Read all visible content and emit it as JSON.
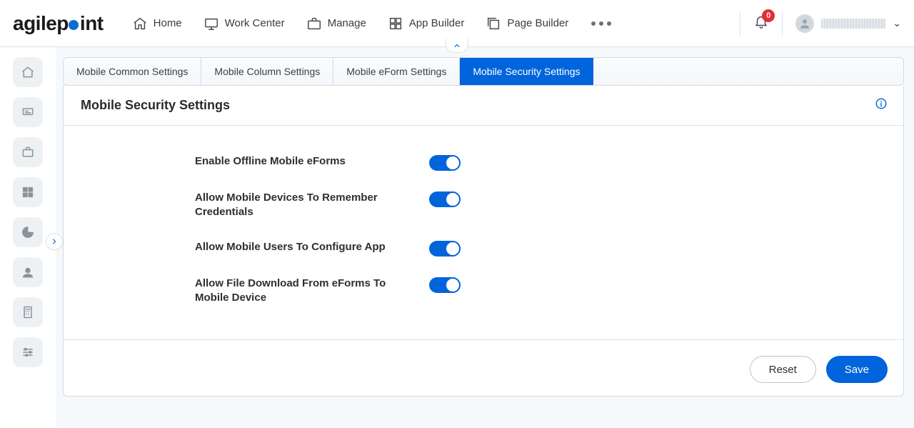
{
  "brand": {
    "name_part1": "agilep",
    "name_part2": "int"
  },
  "nav": {
    "items": [
      {
        "label": "Home"
      },
      {
        "label": "Work Center"
      },
      {
        "label": "Manage"
      },
      {
        "label": "App Builder"
      },
      {
        "label": "Page Builder"
      }
    ]
  },
  "notifications": {
    "count": "0"
  },
  "tabs": {
    "items": [
      {
        "label": "Mobile Common Settings",
        "active": false
      },
      {
        "label": "Mobile Column Settings",
        "active": false
      },
      {
        "label": "Mobile eForm Settings",
        "active": false
      },
      {
        "label": "Mobile Security Settings",
        "active": true
      }
    ]
  },
  "page": {
    "title": "Mobile Security Settings"
  },
  "settings": {
    "items": [
      {
        "label": "Enable Offline Mobile eForms",
        "on": true
      },
      {
        "label": "Allow Mobile Devices To Remember Credentials",
        "on": true
      },
      {
        "label": "Allow Mobile Users To Configure App",
        "on": true
      },
      {
        "label": "Allow File Download From eForms To Mobile Device",
        "on": true
      }
    ]
  },
  "buttons": {
    "reset": "Reset",
    "save": "Save"
  },
  "colors": {
    "primary": "#0064dc",
    "accent": "#0a6ed1",
    "danger": "#e72b3b"
  }
}
